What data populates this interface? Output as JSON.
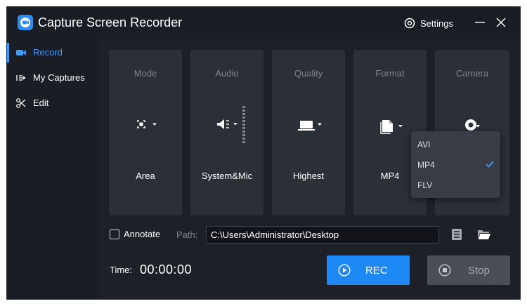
{
  "app": {
    "title": "Capture Screen Recorder"
  },
  "header": {
    "settings_label": "Settings"
  },
  "sidebar": {
    "items": [
      {
        "label": "Record",
        "icon": "video-camera-icon",
        "active": true
      },
      {
        "label": "My Captures",
        "icon": "captures-icon",
        "active": false
      },
      {
        "label": "Edit",
        "icon": "edit-icon",
        "active": false
      }
    ]
  },
  "panels": [
    {
      "title": "Mode",
      "value": "Area",
      "icon": "area-select-icon"
    },
    {
      "title": "Audio",
      "value": "System&Mic",
      "icon": "speaker-icon"
    },
    {
      "title": "Quality",
      "value": "Highest",
      "icon": "laptop-icon"
    },
    {
      "title": "Format",
      "value": "MP4",
      "icon": "file-icon"
    },
    {
      "title": "Camera",
      "value": "",
      "icon": "webcam-icon"
    }
  ],
  "format_dropdown": {
    "options": [
      "AVI",
      "MP4",
      "FLV"
    ],
    "selected": "MP4"
  },
  "options": {
    "annotate_label": "Annotate",
    "annotate_checked": false,
    "path_label": "Path:",
    "path_value": "C:\\Users\\Administrator\\Desktop"
  },
  "recording": {
    "time_label": "Time:",
    "time_value": "00:00:00",
    "rec_label": "REC",
    "stop_label": "Stop"
  },
  "colors": {
    "accent": "#1e88f4",
    "active_text": "#3a9bff",
    "background": "#1d2027",
    "panel": "#2b2f36"
  }
}
